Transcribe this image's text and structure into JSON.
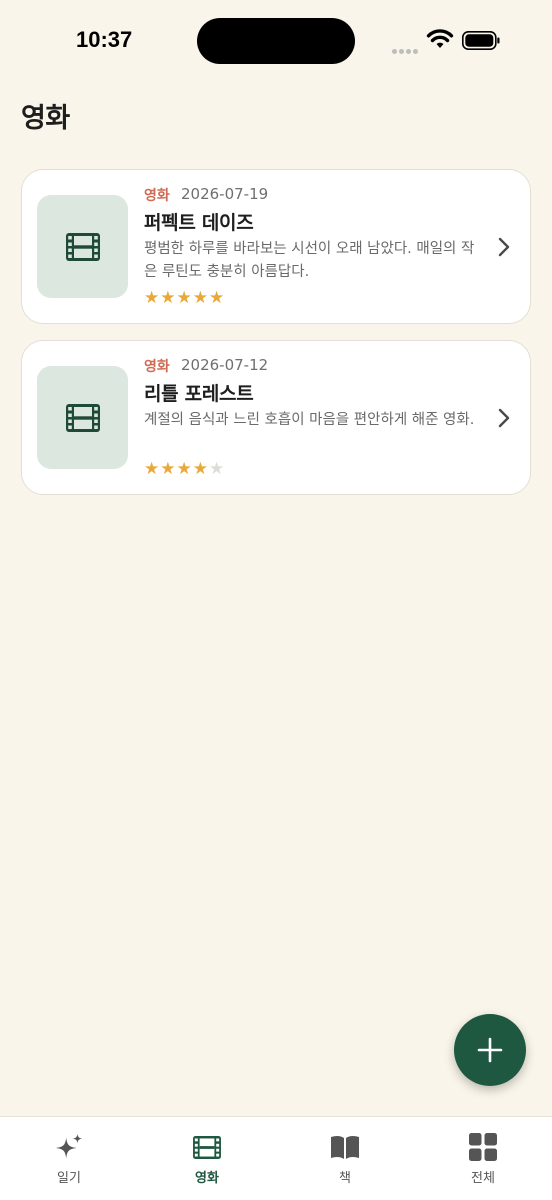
{
  "status_bar": {
    "time": "10:37"
  },
  "header": {
    "title": "영화"
  },
  "entries": [
    {
      "category": "영화",
      "date": "2026-07-19",
      "title": "퍼펙트 데이즈",
      "description": "평범한 하루를 바라보는 시선이 오래 남았다. 매일의 작은 루틴도 충분히 아름답다.",
      "rating": 5,
      "rating_max": 5,
      "thumbnail_icon": "film-icon"
    },
    {
      "category": "영화",
      "date": "2026-07-12",
      "title": "리틀 포레스트",
      "description": "계절의 음식과 느린 호흡이 마음을 편안하게 해준 영화.",
      "rating": 4,
      "rating_max": 5,
      "thumbnail_icon": "film-icon"
    }
  ],
  "fab": {
    "icon": "plus-icon"
  },
  "tabs": [
    {
      "label": "일기",
      "icon": "sparkle-icon",
      "active": false
    },
    {
      "label": "영화",
      "icon": "film-icon",
      "active": true
    },
    {
      "label": "책",
      "icon": "book-icon",
      "active": false
    },
    {
      "label": "전체",
      "icon": "grid-icon",
      "active": false
    }
  ],
  "colors": {
    "background": "#f9f5ea",
    "accent": "#1f5840",
    "category": "#cf6b52",
    "star": "#e8a93a",
    "thumb_bg": "#dbe7df"
  }
}
